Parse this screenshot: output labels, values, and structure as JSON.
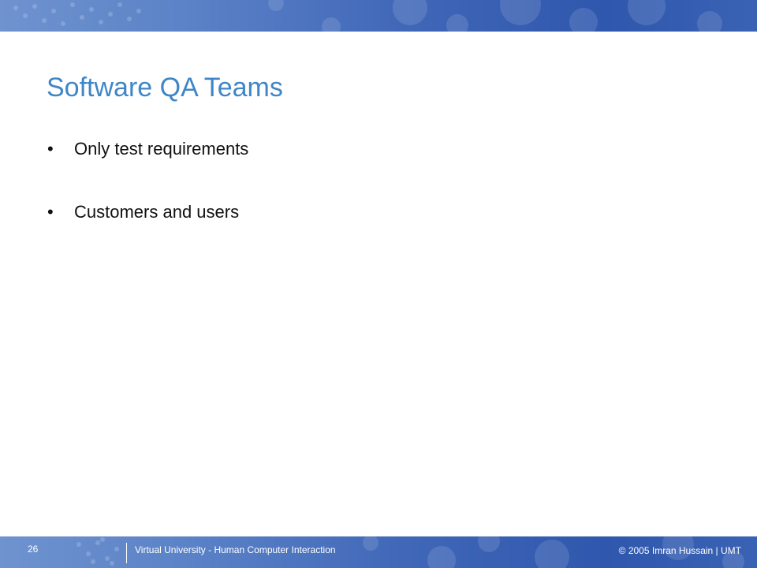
{
  "slide": {
    "title": "Software QA Teams",
    "bullets": [
      {
        "mark": "•",
        "text": "Only test requirements"
      },
      {
        "mark": "•",
        "text": "Customers and users"
      }
    ]
  },
  "footer": {
    "page_number": "26",
    "course": "Virtual University - Human Computer Interaction",
    "copyright": "© 2005 Imran Hussain | UMT"
  },
  "colors": {
    "band": "#3f66b7",
    "title": "#3e86c8",
    "text": "#111111",
    "background": "#ffffff"
  }
}
